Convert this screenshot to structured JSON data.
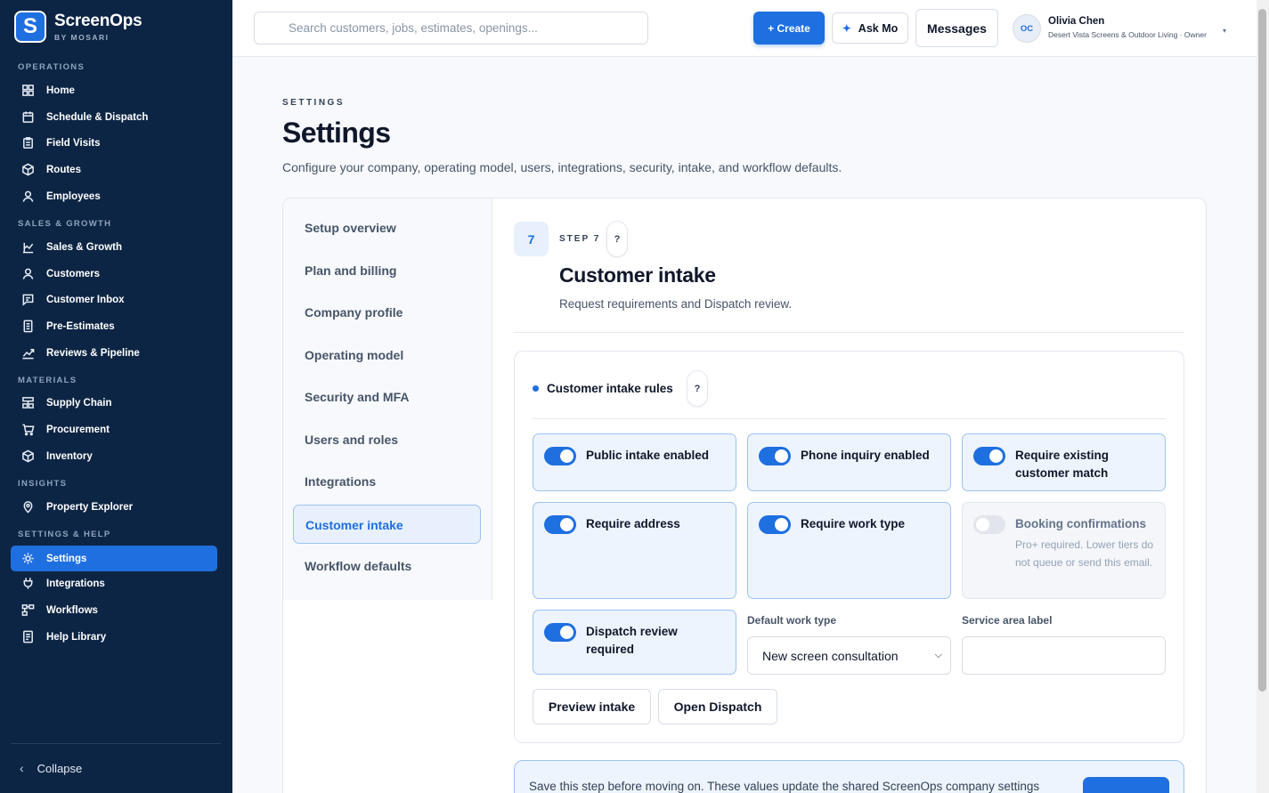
{
  "app": {
    "name": "ScreenOps",
    "subtitle": "BY MOSARI",
    "logo_letter": "S"
  },
  "colors": {
    "sidebar": "#0d2544",
    "accent": "#1e6fe0",
    "tile_on": "#edf4fd"
  },
  "sidebar": {
    "sections": [
      "OPERATIONS",
      "SALES & GROWTH",
      "MATERIALS",
      "INSIGHTS",
      "SETTINGS & HELP"
    ],
    "items": [
      {
        "label": "Home",
        "icon": "grid-icon"
      },
      {
        "label": "Schedule & Dispatch",
        "icon": "calendar-icon"
      },
      {
        "label": "Field Visits",
        "icon": "clipboard-icon"
      },
      {
        "label": "Routes",
        "icon": "box-icon"
      },
      {
        "label": "Employees",
        "icon": "user-icon"
      },
      {
        "label": "Sales & Growth",
        "icon": "bar-chart-icon"
      },
      {
        "label": "Customers",
        "icon": "user-icon"
      },
      {
        "label": "Customer Inbox",
        "icon": "message-icon"
      },
      {
        "label": "Pre-Estimates",
        "icon": "document-icon"
      },
      {
        "label": "Reviews & Pipeline",
        "icon": "trend-icon"
      },
      {
        "label": "Supply Chain",
        "icon": "layers-icon"
      },
      {
        "label": "Procurement",
        "icon": "cart-icon"
      },
      {
        "label": "Inventory",
        "icon": "box-icon"
      },
      {
        "label": "Property Explorer",
        "icon": "map-pin-icon"
      },
      {
        "label": "Settings",
        "icon": "gear-icon",
        "active": true
      },
      {
        "label": "Integrations",
        "icon": "plug-icon"
      },
      {
        "label": "Workflows",
        "icon": "workflow-icon"
      },
      {
        "label": "Help Library",
        "icon": "book-icon"
      }
    ],
    "collapse_label": "Collapse"
  },
  "header": {
    "search_placeholder": "Search customers, jobs, estimates, openings...",
    "create_label": "+ Create",
    "ask_label": "Ask Mo",
    "messages_label": "Messages",
    "user": {
      "initials": "OC",
      "name": "Olivia Chen",
      "org": "Desert Vista Screens & Outdoor Living · Owner"
    }
  },
  "page": {
    "eyebrow": "SETTINGS",
    "title": "Settings",
    "description": "Configure your company, operating model, users, integrations, security, intake, and workflow defaults."
  },
  "steps": [
    {
      "label": "Setup overview"
    },
    {
      "label": "Plan and billing"
    },
    {
      "label": "Company profile"
    },
    {
      "label": "Operating model"
    },
    {
      "label": "Security and MFA"
    },
    {
      "label": "Users and roles"
    },
    {
      "label": "Integrations"
    },
    {
      "label": "Customer intake",
      "active": true
    },
    {
      "label": "Workflow defaults"
    }
  ],
  "section": {
    "step_number": "7",
    "step_label": "STEP 7",
    "help": "?",
    "title": "Customer intake",
    "description": "Request requirements and Dispatch review."
  },
  "rules": {
    "title": "Customer intake rules",
    "help": "?",
    "toggles": [
      {
        "label": "Public intake enabled",
        "on": true
      },
      {
        "label": "Phone inquiry enabled",
        "on": true
      },
      {
        "label": "Require existing customer match",
        "on": true
      },
      {
        "label": "Require address",
        "on": true
      },
      {
        "label": "Require work type",
        "on": true
      },
      {
        "label": "Booking confirmations",
        "on": false,
        "note": "Pro+ required. Lower tiers do not queue or send this email."
      },
      {
        "label": "Dispatch review required",
        "on": true
      }
    ],
    "default_work_type_label": "Default work type",
    "default_work_type_value": "New screen consultation",
    "service_area_label": "Service area label",
    "service_area_value": "",
    "preview_label": "Preview intake",
    "open_dispatch_label": "Open Dispatch"
  },
  "save_notice": {
    "text": "Save this step before moving on. These values update the shared ScreenOps company settings"
  }
}
